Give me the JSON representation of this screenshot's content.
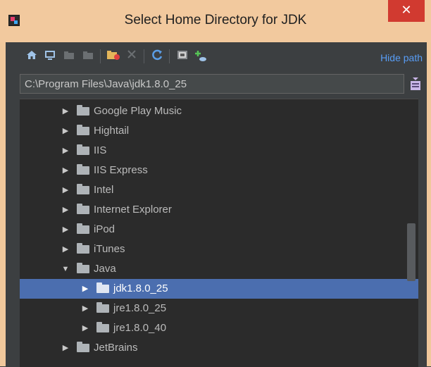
{
  "window": {
    "title": "Select Home Directory for JDK",
    "close_label": "✕"
  },
  "toolbar": {
    "hide_path_label": "Hide path",
    "icons": [
      "home-icon",
      "desktop-icon",
      "project-icon",
      "module-icon",
      "new-folder-icon",
      "delete-icon",
      "refresh-icon",
      "show-hidden-icon",
      "add-icon"
    ]
  },
  "path": {
    "value": "C:\\Program Files\\Java\\jdk1.8.0_25"
  },
  "tree": {
    "rows": [
      {
        "label": "Google Play Music",
        "expanded": false,
        "selected": false
      },
      {
        "label": "Hightail",
        "expanded": false,
        "selected": false
      },
      {
        "label": "IIS",
        "expanded": false,
        "selected": false
      },
      {
        "label": "IIS Express",
        "expanded": false,
        "selected": false
      },
      {
        "label": "Intel",
        "expanded": false,
        "selected": false
      },
      {
        "label": "Internet Explorer",
        "expanded": false,
        "selected": false
      },
      {
        "label": "iPod",
        "expanded": false,
        "selected": false
      },
      {
        "label": "iTunes",
        "expanded": false,
        "selected": false
      },
      {
        "label": "Java",
        "expanded": true,
        "selected": false
      },
      {
        "label": "jdk1.8.0_25",
        "expanded": false,
        "selected": true
      },
      {
        "label": "jre1.8.0_25",
        "expanded": false,
        "selected": false
      },
      {
        "label": "jre1.8.0_40",
        "expanded": false,
        "selected": false
      },
      {
        "label": "JetBrains",
        "expanded": false,
        "selected": false
      }
    ]
  },
  "colors": {
    "title_bar": "#f2c99e",
    "close_button": "#d13a30",
    "selection": "#4b6eaf",
    "link": "#589df6"
  }
}
